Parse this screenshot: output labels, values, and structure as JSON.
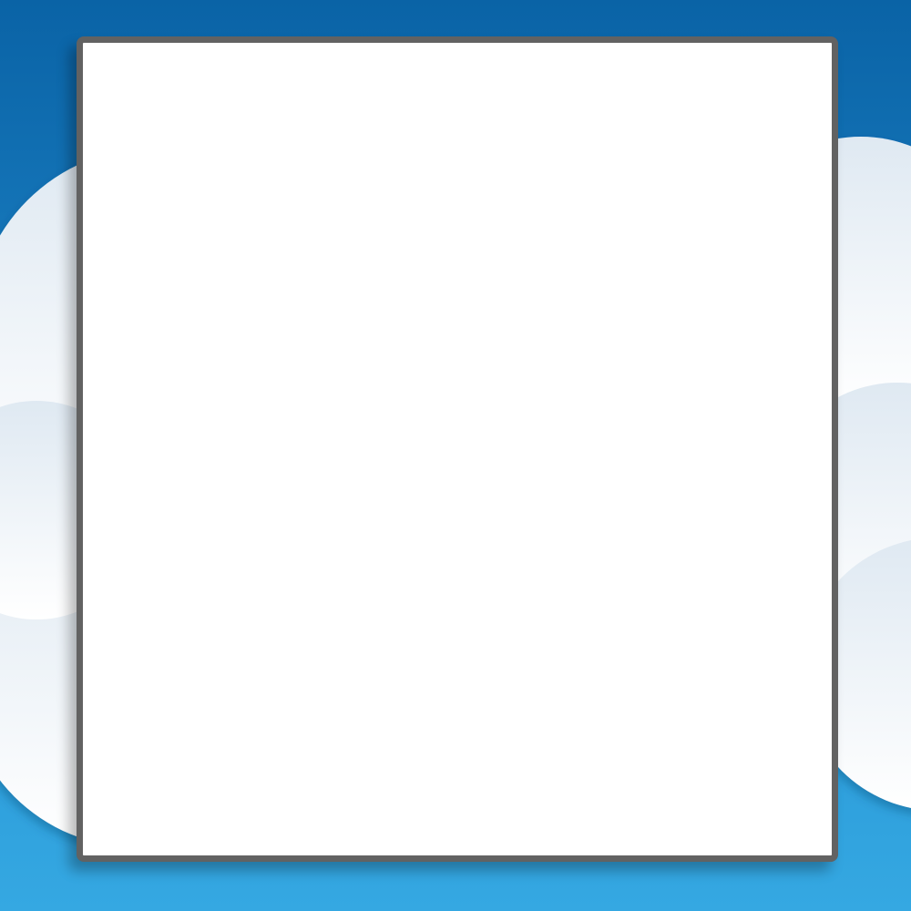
{
  "background": {
    "sky_top_color": "#0a63a6",
    "sky_bottom_color": "#35a8e2",
    "cloud_color": "#ffffff",
    "cloud_shade_color": "#dfe9f2"
  },
  "panel": {
    "fill_color": "#ffffff",
    "border_color": "#626262",
    "content": ""
  }
}
